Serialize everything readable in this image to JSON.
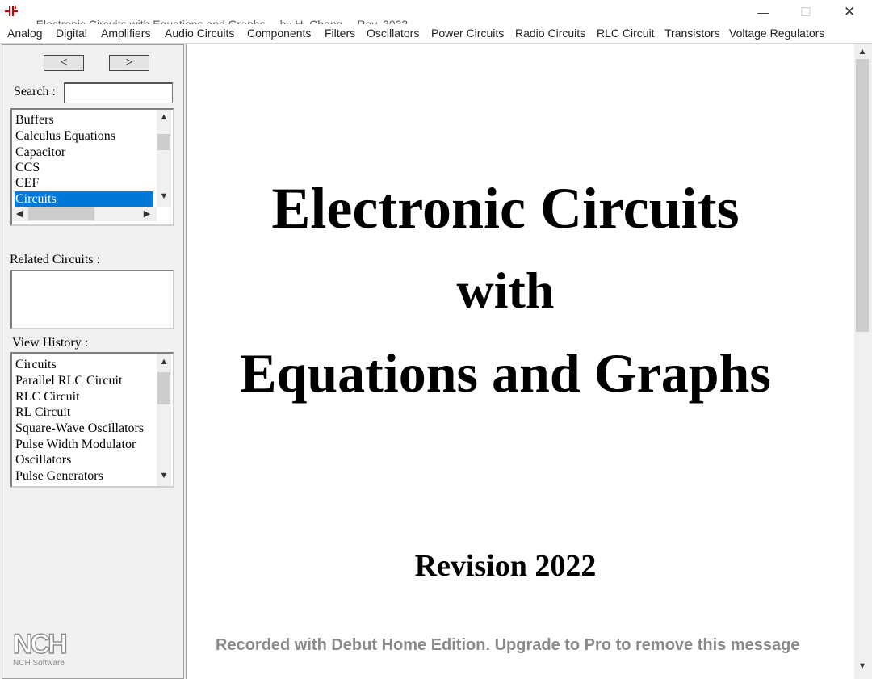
{
  "window": {
    "title_parts": [
      "Electronic Circuits with Equations and Graphs",
      "by H. Chang",
      "Rev. 2022"
    ],
    "controls": {
      "minimize": "—",
      "maximize": "☐",
      "close": "✕"
    }
  },
  "menu": [
    "Analog",
    "Digital",
    "Amplifiers",
    "Audio Circuits",
    "Components",
    "Filters",
    "Oscillators",
    "Power Circuits",
    "Radio Circuits",
    "RLC Circuit",
    "Transistors",
    "Voltage Regulators"
  ],
  "sidebar": {
    "back_label": "<",
    "forward_label": ">",
    "search_label": "Search :",
    "search_value": "",
    "topics": [
      "Buffers",
      "Calculus Equations",
      "Capacitor",
      "CCS",
      "CEF",
      "Circuits"
    ],
    "selected_topic": "Circuits",
    "related_label": "Related Circuits :",
    "related": [],
    "history_label": "View History :",
    "history": [
      "Circuits",
      "Parallel RLC Circuit",
      "RLC Circuit",
      "RL Circuit",
      "Square-Wave Oscillators",
      "Pulse Width Modulator",
      "Oscillators",
      "Pulse Generators"
    ]
  },
  "main": {
    "title_line1": "Electronic Circuits",
    "title_line2": "with",
    "title_line3": "Equations and Graphs",
    "revision": "Revision 2022"
  },
  "overlay": {
    "watermark": "Recorded with Debut Home Edition. Upgrade to Pro to remove this message",
    "logo_text": "NCH",
    "logo_sub": "NCH Software"
  },
  "icons": {
    "app": "circuit-icon",
    "scroll_up": "▲",
    "scroll_down": "▼",
    "scroll_left": "◀",
    "scroll_right": "▶"
  },
  "colors": {
    "selection": "#0078d7",
    "watermark": "#8a8a8a"
  }
}
